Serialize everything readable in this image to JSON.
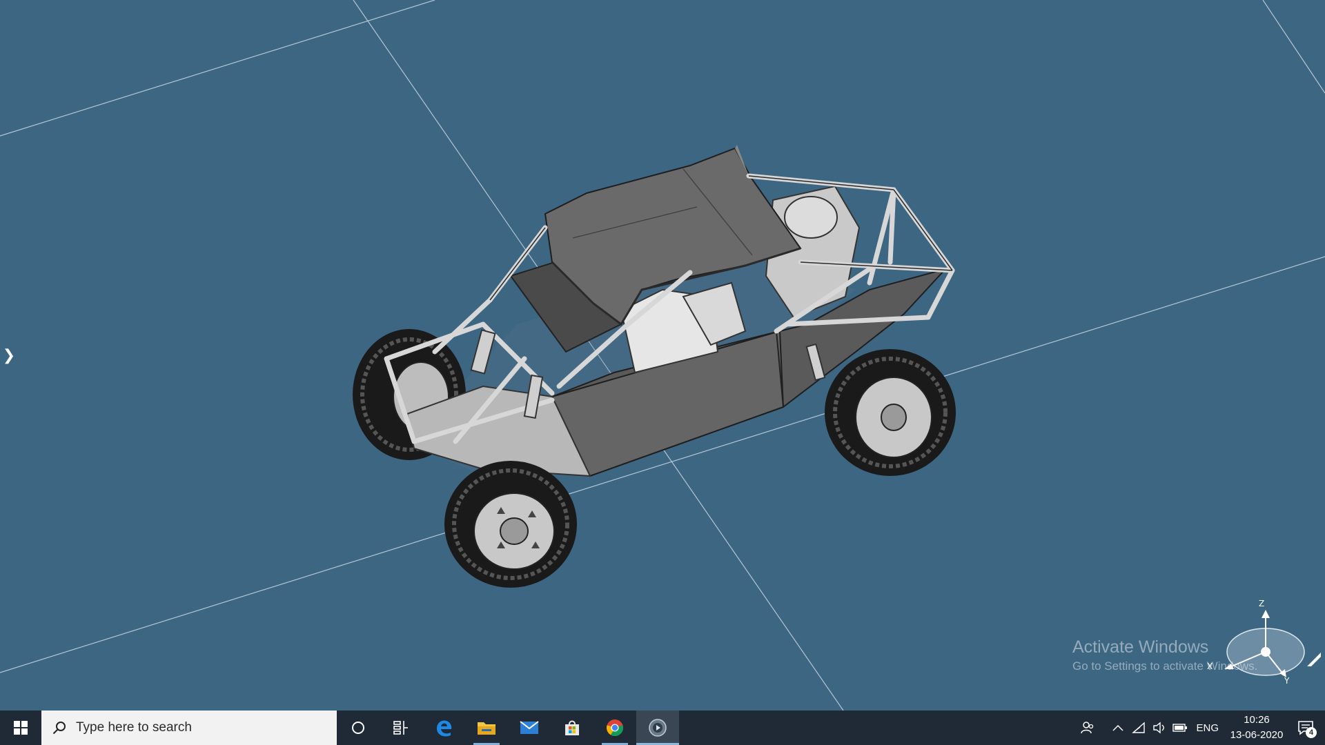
{
  "viewport": {
    "background_color": "#3d6683",
    "model_name_icon": "buggy-3d-model",
    "expand_icon": "chevron-right-icon"
  },
  "watermark": {
    "title": "Activate Windows",
    "subtitle": "Go to Settings to activate Windows."
  },
  "triad": {
    "z": "Z",
    "x": "X",
    "y": "Y"
  },
  "taskbar": {
    "search_placeholder": "Type here to search",
    "apps": [
      {
        "name": "cortana",
        "icon": "circle-icon"
      },
      {
        "name": "task-view",
        "icon": "task-view-icon"
      },
      {
        "name": "edge",
        "icon": "edge-icon"
      },
      {
        "name": "file-explorer",
        "icon": "folder-icon"
      },
      {
        "name": "mail",
        "icon": "mail-icon"
      },
      {
        "name": "store",
        "icon": "store-icon"
      },
      {
        "name": "chrome",
        "icon": "chrome-icon"
      },
      {
        "name": "cad-viewer",
        "icon": "cad-app-icon"
      }
    ],
    "language": "ENG",
    "time": "10:26",
    "date": "13-06-2020",
    "notification_count": "4"
  }
}
